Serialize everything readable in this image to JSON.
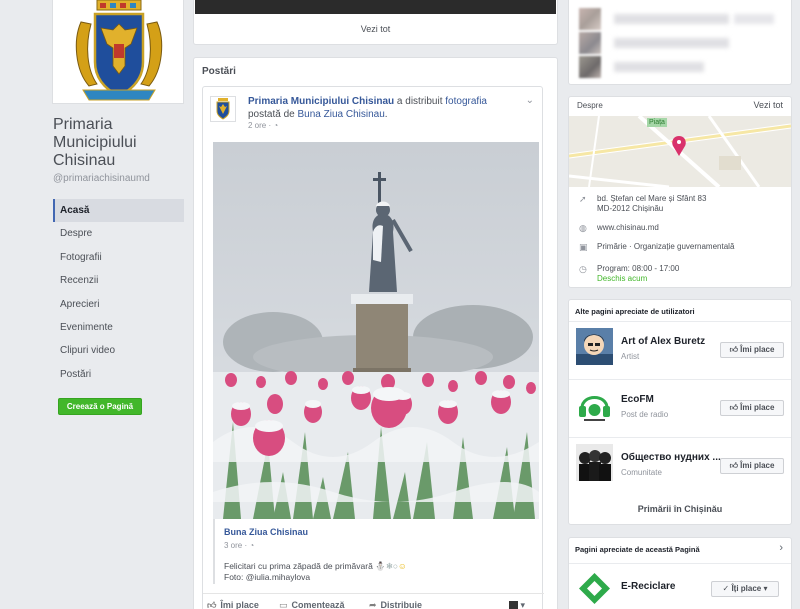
{
  "page": {
    "name": "Primaria Municipiului Chisinau",
    "handle": "@primariachisinaumd",
    "nav": [
      "Acasă",
      "Despre",
      "Fotografii",
      "Recenzii",
      "Aprecieri",
      "Evenimente",
      "Clipuri video",
      "Postări"
    ],
    "active_nav": "Acasă",
    "create_page_label": "Creează o Pagină"
  },
  "top_card": {
    "link": "Vezi tot"
  },
  "posts": {
    "title": "Postări",
    "post": {
      "author": "Primaria Municipiului Chisinau",
      "verb": "a distribuit",
      "object": "fotografia",
      "object_suffix": "postată de",
      "shared_from": "Buna Ziua Chisinau",
      "time": "2 ore",
      "share": {
        "name": "Buna Ziua Chisinau",
        "time": "3 ore",
        "text_line1": "Felicitari cu prima zăpadă de primăvară",
        "text_line2": "Foto: @iulia.mihaylova"
      },
      "actions": {
        "like": "Îmi place",
        "comment": "Comentează",
        "share": "Distribuie"
      }
    }
  },
  "about": {
    "title": "Despre",
    "link": "Vezi tot",
    "map_label": "Piața",
    "address_line1": "bd. Ștefan cel Mare și Sfânt 83",
    "address_line2": "MD-2012 Chișinău",
    "website": "www.chisinau.md",
    "category": "Primărie · Organizație guvernamentală",
    "hours": "Program: 08:00 - 17:00",
    "open_status": "Deschis acum"
  },
  "liked_pages": {
    "title": "Alte pagini apreciate de utilizatori",
    "like_label": "Îmi place",
    "items": [
      {
        "name": "Art of Alex Buretz",
        "category": "Artist"
      },
      {
        "name": "EcoFM",
        "category": "Post de radio"
      },
      {
        "name": "Общество нудних ...",
        "category": "Comunitate"
      }
    ],
    "footer_link": "Primării în Chișinău"
  },
  "related": {
    "title": "Pagini apreciate de această Pagină",
    "item_name": "E-Reciclare",
    "liked_label": "Îți place"
  },
  "colors": {
    "accent": "#4267b2",
    "link": "#365899",
    "green": "#42b72a",
    "background": "#e9ebee"
  }
}
